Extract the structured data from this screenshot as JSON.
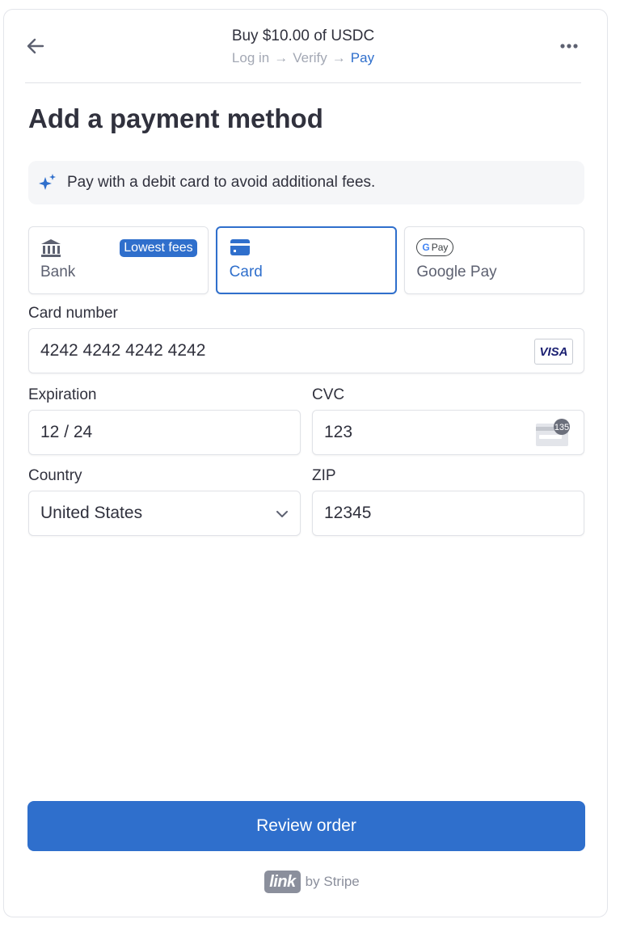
{
  "header": {
    "title": "Buy $10.00 of USDC",
    "steps": [
      "Log in",
      "Verify",
      "Pay"
    ],
    "active_step": "Pay",
    "back_icon": "arrow-left-icon",
    "menu_icon": "more-horizontal-icon"
  },
  "page_title": "Add a payment method",
  "notice": {
    "icon": "sparkle-icon",
    "text": "Pay with a debit card to avoid additional fees."
  },
  "methods": [
    {
      "label": "Bank",
      "icon": "bank-icon",
      "badge": "Lowest fees",
      "selected": false
    },
    {
      "label": "Card",
      "icon": "card-icon",
      "selected": true
    },
    {
      "label": "Google Pay",
      "icon": "google-pay-icon",
      "icon_text": "Pay",
      "icon_g": "G",
      "selected": false
    }
  ],
  "form": {
    "card_number": {
      "label": "Card number",
      "value": "4242 4242 4242 4242",
      "brand": "VISA"
    },
    "expiration": {
      "label": "Expiration",
      "value": "12 / 24"
    },
    "cvc": {
      "label": "CVC",
      "value": "123",
      "icon_text": "135"
    },
    "country": {
      "label": "Country",
      "value": "United States"
    },
    "zip": {
      "label": "ZIP",
      "value": "12345"
    }
  },
  "review_button": "Review order",
  "footer": {
    "logo": "link",
    "text": "by Stripe"
  },
  "colors": {
    "accent": "#2f6fcc",
    "text": "#30313d",
    "muted": "#a3a8b4"
  }
}
